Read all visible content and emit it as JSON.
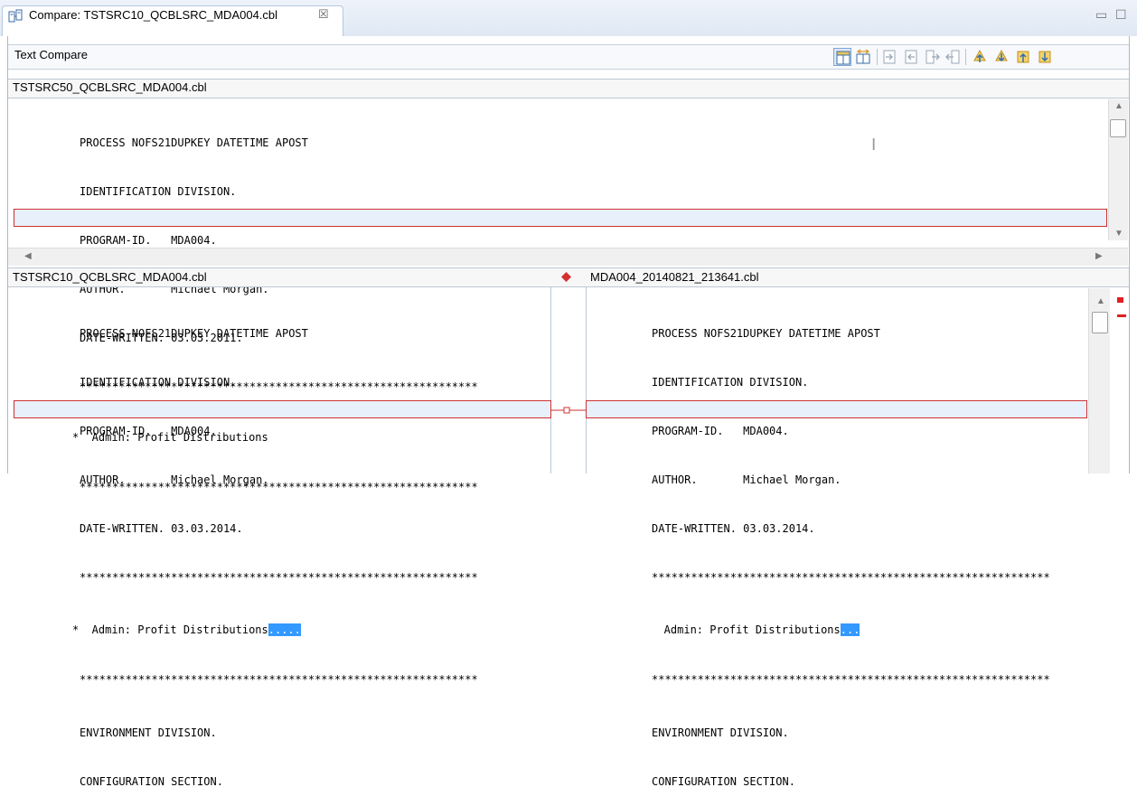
{
  "tab": {
    "title": "Compare: TSTSRC10_QCBLSRC_MDA004.cbl",
    "close": "☒"
  },
  "window_controls": {
    "minimize": "▭",
    "maximize": "☐"
  },
  "header": {
    "title": "Text Compare"
  },
  "ancestor": {
    "filename": "TSTSRC50_QCBLSRC_MDA004.cbl",
    "lines": [
      "PROCESS NOFS21DUPKEY DATETIME APOST",
      "IDENTIFICATION DIVISION.",
      "PROGRAM-ID.   MDA004.",
      "AUTHOR.       Michael Morgan.",
      "DATE-WRITTEN. 03.03.2011.",
      "*************************************************************",
      "*  Admin: Profit Distributions",
      "*************************************************************"
    ]
  },
  "left": {
    "filename": "TSTSRC10_QCBLSRC_MDA004.cbl",
    "lines": [
      "PROCESS NOFS21DUPKEY DATETIME APOST",
      "IDENTIFICATION DIVISION.",
      "PROGRAM-ID.   MDA004.",
      "AUTHOR.       Michael Morgan.",
      "DATE-WRITTEN. 03.03.2014.",
      "*************************************************************",
      "*  Admin: Profit Distributions",
      "*************************************************************",
      "ENVIRONMENT DIVISION.",
      "CONFIGURATION SECTION."
    ],
    "diff_text": "....."
  },
  "right": {
    "filename": "MDA004_20140821_213641.cbl",
    "lines": [
      "PROCESS NOFS21DUPKEY DATETIME APOST",
      "IDENTIFICATION DIVISION.",
      "PROGRAM-ID.   MDA004.",
      "AUTHOR.       Michael Morgan.",
      "DATE-WRITTEN. 03.03.2014.",
      "*************************************************************",
      "*  Admin: Profit Distributions",
      "*************************************************************",
      "ENVIRONMENT DIVISION.",
      "CONFIGURATION SECTION."
    ],
    "diff_text": "..."
  },
  "colors": {
    "diff_border": "#d03030",
    "selection": "#3399ff",
    "diff_bg": "#e8f0fb",
    "center_diamond": "#d42f2f"
  },
  "icons": {
    "toolbar": [
      "ancestor-pane-icon",
      "swap-sides-icon",
      "copy-all-left-to-right-icon",
      "copy-left-to-right-icon",
      "copy-all-right-to-left-icon",
      "copy-right-to-left-icon",
      "next-difference-icon",
      "previous-difference-icon",
      "next-change-icon",
      "previous-change-icon"
    ]
  }
}
